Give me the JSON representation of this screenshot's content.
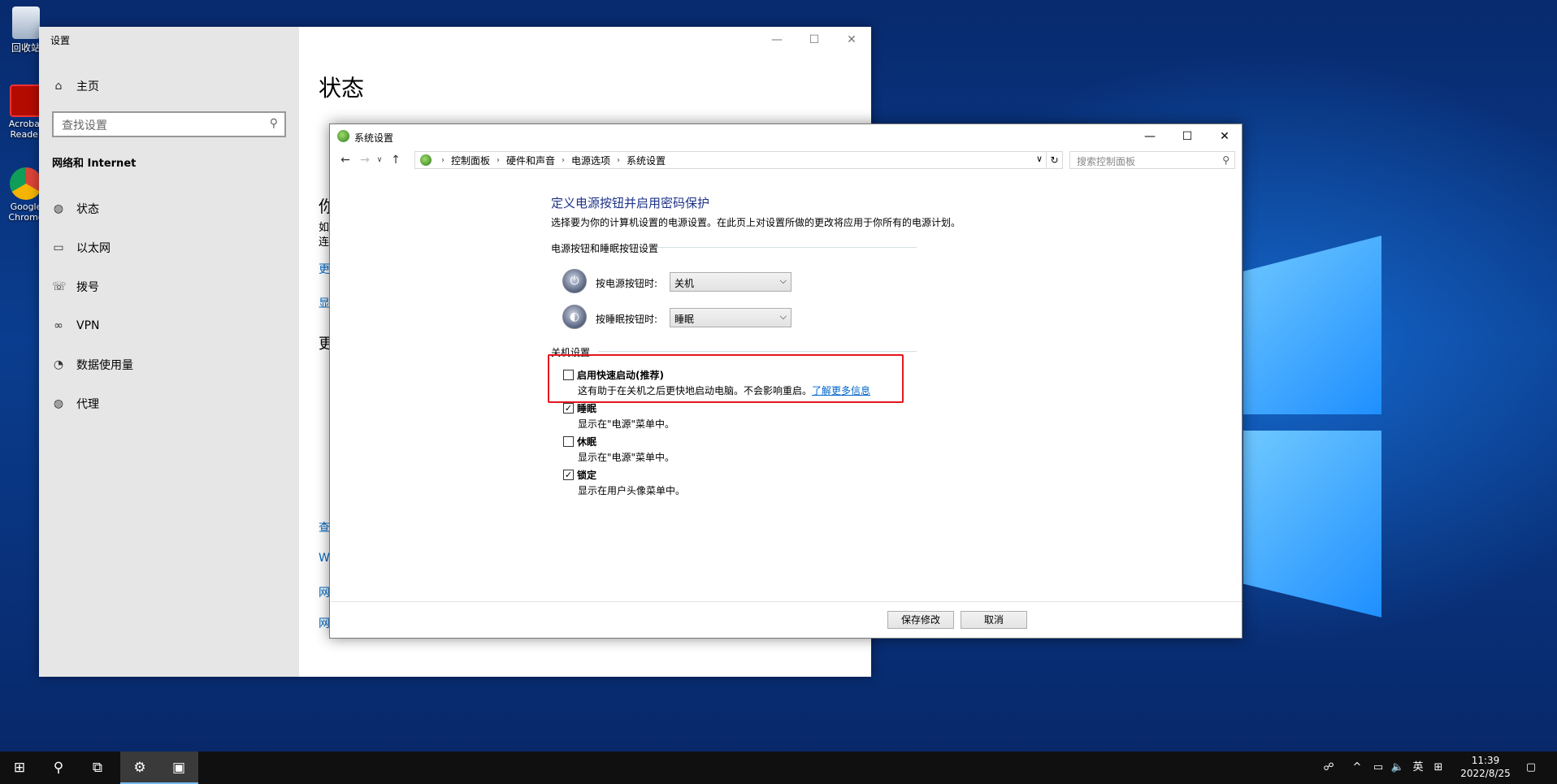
{
  "desktop": {
    "icons": [
      {
        "label": "回收站"
      },
      {
        "label": "Acrobat Reader"
      },
      {
        "label": "Google Chrome"
      }
    ]
  },
  "settings_window": {
    "title": "设置",
    "home_label": "主页",
    "search_placeholder": "查找设置",
    "section_title": "网络和 Internet",
    "nav": [
      {
        "label": "状态",
        "icon": "globe-icon"
      },
      {
        "label": "以太网",
        "icon": "monitor-icon"
      },
      {
        "label": "拨号",
        "icon": "dialup-icon"
      },
      {
        "label": "VPN",
        "icon": "vpn-icon"
      },
      {
        "label": "数据使用量",
        "icon": "data-usage-icon"
      },
      {
        "label": "代理",
        "icon": "globe-icon"
      }
    ],
    "main_title": "状态",
    "cut_texts": [
      "你",
      "如",
      "连",
      "更",
      "显",
      "更",
      "查",
      "W",
      "网",
      "网"
    ]
  },
  "system_settings": {
    "title": "系统设置",
    "breadcrumb": [
      "控制面板",
      "硬件和声音",
      "电源选项",
      "系统设置"
    ],
    "search_placeholder": "搜索控制面板",
    "heading": "定义电源按钮并启用密码保护",
    "description": "选择要为你的计算机设置的电源设置。在此页上对设置所做的更改将应用于你所有的电源计划。",
    "power_section": "电源按钮和睡眠按钮设置",
    "power_button_label": "按电源按钮时:",
    "power_button_value": "关机",
    "sleep_button_label": "按睡眠按钮时:",
    "sleep_button_value": "睡眠",
    "shutdown_section": "关机设置",
    "options": [
      {
        "label": "启用快速启动(推荐)",
        "desc": "这有助于在关机之后更快地启动电脑。不会影响重启。",
        "link": "了解更多信息",
        "checked": false
      },
      {
        "label": "睡眠",
        "desc": "显示在\"电源\"菜单中。",
        "checked": true
      },
      {
        "label": "休眠",
        "desc": "显示在\"电源\"菜单中。",
        "checked": false
      },
      {
        "label": "锁定",
        "desc": "显示在用户头像菜单中。",
        "checked": true
      }
    ],
    "save_label": "保存修改",
    "cancel_label": "取消",
    "highlight_color": "#e3171e"
  },
  "taskbar": {
    "ime": "英",
    "time": "11:39",
    "date": "2022/8/25"
  }
}
